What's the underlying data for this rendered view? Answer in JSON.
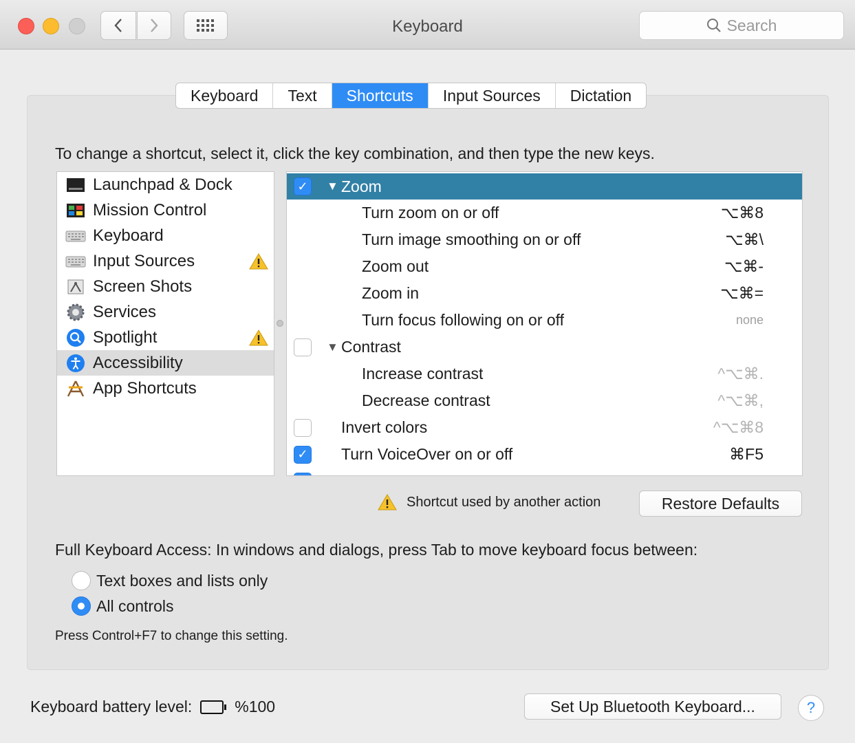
{
  "window": {
    "title": "Keyboard",
    "search_placeholder": "Search"
  },
  "tabs": [
    {
      "label": "Keyboard"
    },
    {
      "label": "Text"
    },
    {
      "label": "Shortcuts",
      "active": true
    },
    {
      "label": "Input Sources"
    },
    {
      "label": "Dictation"
    }
  ],
  "instructions": "To change a shortcut, select it, click the key combination, and then type the new keys.",
  "categories": [
    {
      "label": "Launchpad & Dock",
      "icon": "launchpad-icon"
    },
    {
      "label": "Mission Control",
      "icon": "mission-control-icon"
    },
    {
      "label": "Keyboard",
      "icon": "keyboard-icon"
    },
    {
      "label": "Input Sources",
      "icon": "keyboard-icon",
      "warning": true
    },
    {
      "label": "Screen Shots",
      "icon": "screenshot-icon"
    },
    {
      "label": "Services",
      "icon": "gear-icon"
    },
    {
      "label": "Spotlight",
      "icon": "spotlight-icon",
      "warning": true
    },
    {
      "label": "Accessibility",
      "icon": "accessibility-icon",
      "selected": true
    },
    {
      "label": "App Shortcuts",
      "icon": "app-shortcuts-icon"
    }
  ],
  "shortcuts": [
    {
      "label": "Zoom",
      "group": true,
      "expanded": true,
      "checked": true,
      "selected": true,
      "keys": ""
    },
    {
      "label": "Turn zoom on or off",
      "keys": "⌥⌘8"
    },
    {
      "label": "Turn image smoothing on or off",
      "keys": "⌥⌘\\"
    },
    {
      "label": "Zoom out",
      "keys": "⌥⌘-"
    },
    {
      "label": "Zoom in",
      "keys": "⌥⌘="
    },
    {
      "label": "Turn focus following on or off",
      "keys": "none"
    },
    {
      "label": "Contrast",
      "group": true,
      "expanded": true,
      "checked": false,
      "keys": ""
    },
    {
      "label": "Increase contrast",
      "keys": "^⌥⌘."
    },
    {
      "label": "Decrease contrast",
      "keys": "^⌥⌘,"
    },
    {
      "label": "Invert colors",
      "checked": false,
      "keys": "^⌥⌘8"
    },
    {
      "label": "Turn VoiceOver on or off",
      "checked": true,
      "keys": "⌘F5"
    }
  ],
  "warning_text": "Shortcut used by another action",
  "restore_label": "Restore Defaults",
  "full_keyboard_access": {
    "label": "Full Keyboard Access: In windows and dialogs, press Tab to move keyboard focus between:",
    "options": [
      {
        "label": "Text boxes and lists only",
        "selected": false
      },
      {
        "label": "All controls",
        "selected": true
      }
    ],
    "hint": "Press Control+F7 to change this setting."
  },
  "battery": {
    "label": "Keyboard battery level:",
    "value": "%100",
    "level": 1.0
  },
  "bluetooth_button": "Set Up Bluetooth Keyboard...",
  "help_label": "?",
  "colors": {
    "accent": "#2f8cf5",
    "selected_row": "#3180a6"
  }
}
